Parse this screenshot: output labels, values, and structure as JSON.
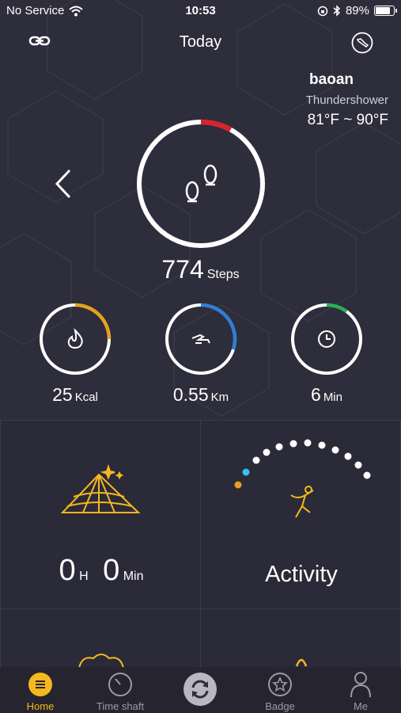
{
  "status_bar": {
    "carrier": "No Service",
    "time": "10:53",
    "battery": "89%",
    "battery_level": 0.89
  },
  "header": {
    "title": "Today",
    "left_icon": "link-icon",
    "right_icon": "shoe-icon"
  },
  "weather": {
    "city": "baoan",
    "condition": "Thundershower",
    "temperature": "81°F ~ 90°F"
  },
  "steps": {
    "value": "774",
    "unit": "Steps",
    "progress": 0.08
  },
  "metrics": [
    {
      "name": "calories",
      "value": "25",
      "unit": "Kcal",
      "icon": "flame-icon",
      "color": "#e5a21f",
      "progress": 0.25
    },
    {
      "name": "distance",
      "value": "0.55",
      "unit": "Km",
      "icon": "run-icon",
      "color": "#2f7fd8",
      "progress": 0.3
    },
    {
      "name": "duration",
      "value": "6",
      "unit": "Min",
      "icon": "clock-icon",
      "color": "#27b15a",
      "progress": 0.1
    }
  ],
  "tiles": {
    "sleep": {
      "hours": "0",
      "h_unit": "H",
      "minutes": "0",
      "min_unit": "Min",
      "icon": "tent-icon"
    },
    "activity": {
      "label": "Activity",
      "icon": "jumping-person-icon"
    }
  },
  "colors": {
    "accent": "#f5b820",
    "ring_steps": "#d9242b",
    "dot_cyan": "#34c3f0",
    "dot_orange": "#e5a21f"
  },
  "tabbar": [
    {
      "label": "Home",
      "icon": "home-list-icon",
      "active": true
    },
    {
      "label": "Time shaft",
      "icon": "gauge-icon",
      "active": false
    },
    {
      "label": "",
      "icon": "sync-icon",
      "active": false
    },
    {
      "label": "Badge",
      "icon": "star-badge-icon",
      "active": false
    },
    {
      "label": "Me",
      "icon": "person-icon",
      "active": false
    }
  ]
}
